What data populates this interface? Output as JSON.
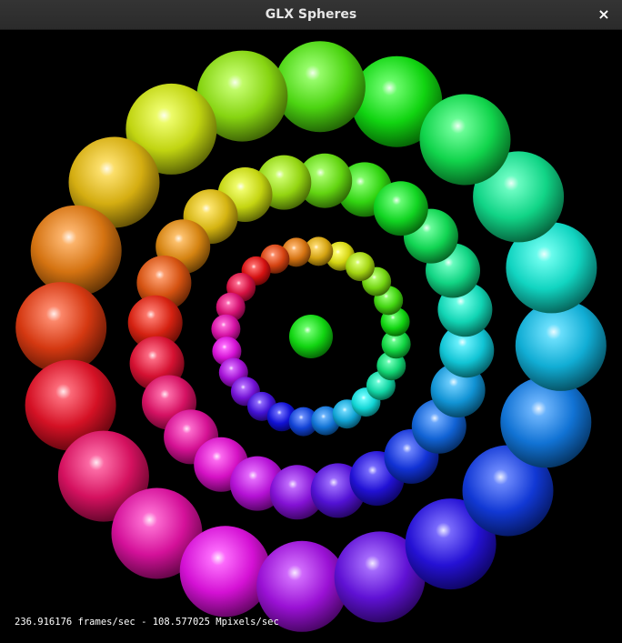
{
  "window": {
    "title": "GLX Spheres",
    "close_glyph": "×"
  },
  "status": {
    "fps_text": "236.916176 frames/sec - 108.577025 Mpixels/sec"
  },
  "scene": {
    "background": "#000000",
    "rings": [
      {
        "name": "outer",
        "count": 20,
        "hue_start": 120,
        "direction": -1
      },
      {
        "name": "middle",
        "count": 24,
        "hue_start": 110,
        "direction": -1
      },
      {
        "name": "inner",
        "count": 24,
        "hue_start": 60,
        "direction": -1
      }
    ],
    "center_sphere_color": "#33dd33"
  }
}
